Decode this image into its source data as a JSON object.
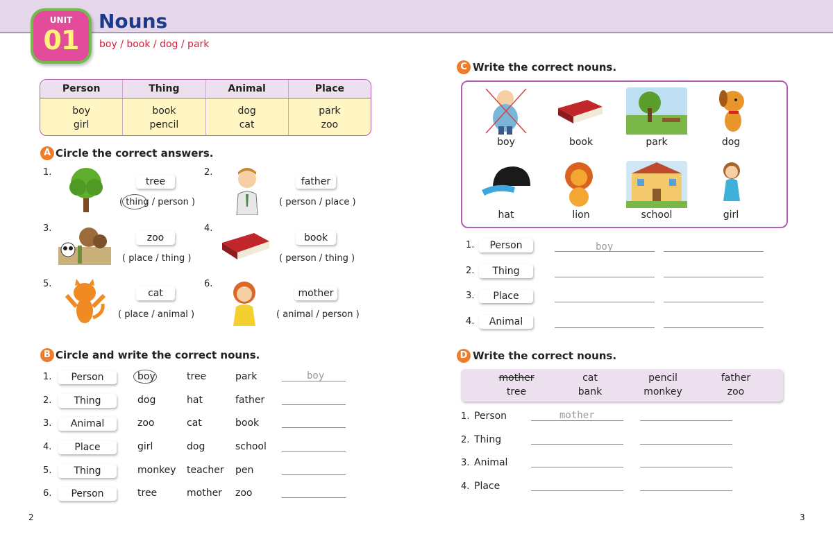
{
  "header": {
    "unit_label": "UNIT",
    "unit_number": "01",
    "title": "Nouns",
    "subtitle": "boy / book / dog / park"
  },
  "noun_table": {
    "headers": [
      "Person",
      "Thing",
      "Animal",
      "Place"
    ],
    "row1": [
      "boy",
      "book",
      "dog",
      "park"
    ],
    "row2": [
      "girl",
      "pencil",
      "cat",
      "zoo"
    ]
  },
  "section_a": {
    "letter": "A",
    "title": "Circle the correct answers.",
    "items": [
      {
        "num": "1.",
        "word": "tree",
        "choice": "( thing  /  person )"
      },
      {
        "num": "2.",
        "word": "father",
        "choice": "( person  /  place )"
      },
      {
        "num": "3.",
        "word": "zoo",
        "choice": "( place  /  thing )"
      },
      {
        "num": "4.",
        "word": "book",
        "choice": "( person  /  thing )"
      },
      {
        "num": "5.",
        "word": "cat",
        "choice": "( place  /  animal )"
      },
      {
        "num": "6.",
        "word": "mother",
        "choice": "( animal  /  person )"
      }
    ]
  },
  "section_b": {
    "letter": "B",
    "title": "Circle and write the correct nouns.",
    "rows": [
      {
        "num": "1.",
        "category": "Person",
        "words": [
          "boy",
          "tree",
          "park"
        ],
        "answer": "boy"
      },
      {
        "num": "2.",
        "category": "Thing",
        "words": [
          "dog",
          "hat",
          "father"
        ],
        "answer": ""
      },
      {
        "num": "3.",
        "category": "Animal",
        "words": [
          "zoo",
          "cat",
          "book"
        ],
        "answer": ""
      },
      {
        "num": "4.",
        "category": "Place",
        "words": [
          "girl",
          "dog",
          "school"
        ],
        "answer": ""
      },
      {
        "num": "5.",
        "category": "Thing",
        "words": [
          "monkey",
          "teacher",
          "pen"
        ],
        "answer": ""
      },
      {
        "num": "6.",
        "category": "Person",
        "words": [
          "tree",
          "mother",
          "zoo"
        ],
        "answer": ""
      }
    ]
  },
  "section_c": {
    "letter": "C",
    "title": "Write the correct nouns.",
    "pictures": [
      "boy",
      "book",
      "park",
      "dog",
      "hat",
      "lion",
      "school",
      "girl"
    ],
    "rows": [
      {
        "num": "1.",
        "category": "Person",
        "answer": "boy"
      },
      {
        "num": "2.",
        "category": "Thing",
        "answer": ""
      },
      {
        "num": "3.",
        "category": "Place",
        "answer": ""
      },
      {
        "num": "4.",
        "category": "Animal",
        "answer": ""
      }
    ]
  },
  "section_d": {
    "letter": "D",
    "title": "Write the correct nouns.",
    "word_row1": [
      "mother",
      "cat",
      "pencil",
      "father"
    ],
    "word_row2": [
      "tree",
      "bank",
      "monkey",
      "zoo"
    ],
    "rows": [
      {
        "num": "1.",
        "category": "Person",
        "answer": "mother"
      },
      {
        "num": "2.",
        "category": "Thing",
        "answer": ""
      },
      {
        "num": "3.",
        "category": "Animal",
        "answer": ""
      },
      {
        "num": "4.",
        "category": "Place",
        "answer": ""
      }
    ]
  },
  "page_numbers": {
    "left": "2",
    "right": "3"
  },
  "colors": {
    "accent_purple": "#b25cb3",
    "header_band": "#e6d6ec",
    "section_orange": "#ee7d2b",
    "title_blue": "#1a3a8a",
    "subtitle_red": "#d41f3c",
    "table_yellow": "#fff6c4"
  }
}
